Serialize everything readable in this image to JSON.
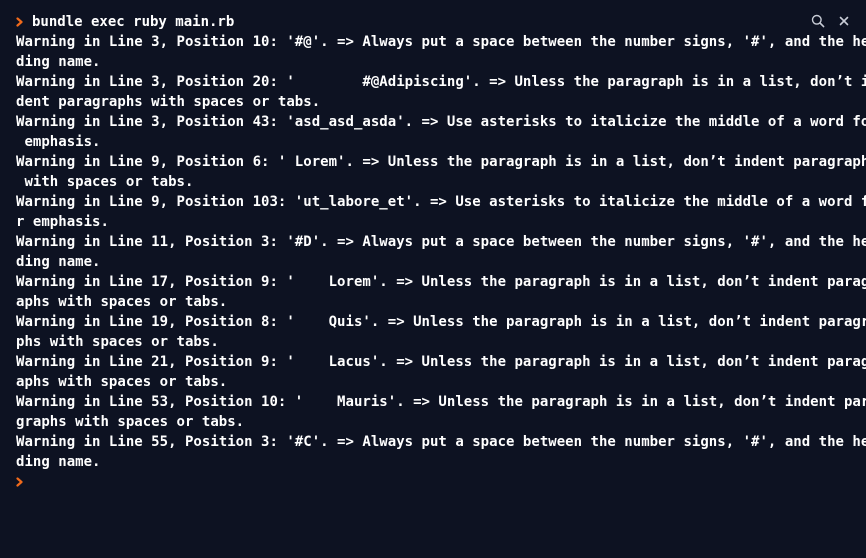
{
  "terminal": {
    "command": "bundle exec ruby main.rb",
    "output_lines": [
      "Warning in Line 3, Position 10: '#@'. => Always put a space between the number signs, '#', and the hea",
      "ding name.",
      "Warning in Line 3, Position 20: '        #@Adipiscing'. => Unless the paragraph is in a list, don’t in",
      "dent paragraphs with spaces or tabs.",
      "Warning in Line 3, Position 43: 'asd_asd_asda'. => Use asterisks to italicize the middle of a word for",
      " emphasis.",
      "Warning in Line 9, Position 6: ' Lorem'. => Unless the paragraph is in a list, don’t indent paragraphs",
      " with spaces or tabs.",
      "Warning in Line 9, Position 103: 'ut_labore_et'. => Use asterisks to italicize the middle of a word fo",
      "r emphasis.",
      "Warning in Line 11, Position 3: '#D'. => Always put a space between the number signs, '#', and the hea",
      "ding name.",
      "Warning in Line 17, Position 9: '    Lorem'. => Unless the paragraph is in a list, don’t indent paragr",
      "aphs with spaces or tabs.",
      "Warning in Line 19, Position 8: '    Quis'. => Unless the paragraph is in a list, don’t indent paragra",
      "phs with spaces or tabs.",
      "Warning in Line 21, Position 9: '    Lacus'. => Unless the paragraph is in a list, don’t indent paragr",
      "aphs with spaces or tabs.",
      "Warning in Line 53, Position 10: '    Mauris'. => Unless the paragraph is in a list, don’t indent para",
      "graphs with spaces or tabs.",
      "Warning in Line 55, Position 3: '#C'. => Always put a space between the number signs, '#', and the hea",
      "ding name."
    ]
  },
  "toolbar": {
    "search_icon": "search-icon",
    "close_icon": "close-icon"
  },
  "colors": {
    "background": "#0d1222",
    "prompt": "#f06a1b",
    "text": "#ffffff"
  }
}
